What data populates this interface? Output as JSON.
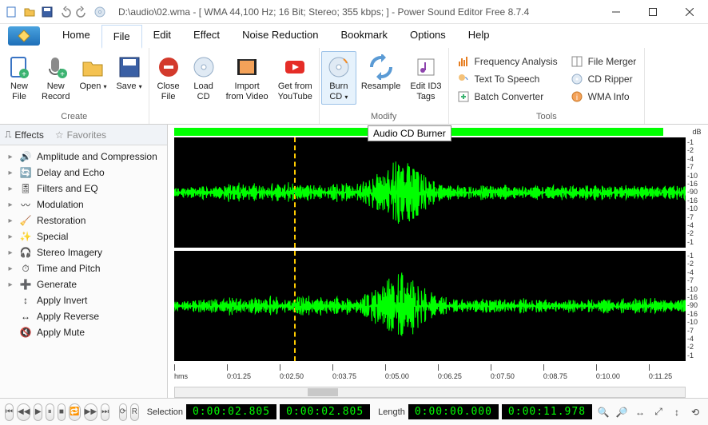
{
  "window": {
    "title": "D:\\audio\\02.wma - [ WMA 44,100 Hz; 16 Bit; Stereo; 355 kbps; ] - Power Sound Editor Free 8.7.4"
  },
  "menu": [
    "Home",
    "File",
    "Edit",
    "Effect",
    "Noise Reduction",
    "Bookmark",
    "Options",
    "Help"
  ],
  "active_menu": "File",
  "ribbon": {
    "groups": [
      {
        "label": "Create",
        "items": [
          {
            "id": "new-file",
            "label": "New\nFile"
          },
          {
            "id": "new-record",
            "label": "New\nRecord"
          },
          {
            "id": "open",
            "label": "Open",
            "drop": true
          },
          {
            "id": "save",
            "label": "Save",
            "drop": true
          }
        ]
      },
      {
        "label": "",
        "items": [
          {
            "id": "close-file",
            "label": "Close\nFile"
          },
          {
            "id": "load-cd",
            "label": "Load\nCD"
          },
          {
            "id": "import-video",
            "label": "Import\nfrom Video"
          },
          {
            "id": "get-youtube",
            "label": "Get from\nYouTube"
          }
        ]
      },
      {
        "label": "Modify",
        "items": [
          {
            "id": "burn-cd",
            "label": "Burn\nCD",
            "drop": true,
            "active": true
          },
          {
            "id": "resample",
            "label": "Resample"
          },
          {
            "id": "edit-id3",
            "label": "Edit ID3\nTags"
          }
        ]
      },
      {
        "label": "Tools",
        "right": true,
        "small": [
          {
            "id": "frequency-analysis",
            "label": "Frequency Analysis"
          },
          {
            "id": "text-to-speech",
            "label": "Text To Speech"
          },
          {
            "id": "batch-converter",
            "label": "Batch Converter"
          }
        ],
        "small2": [
          {
            "id": "file-merger",
            "label": "File Merger"
          },
          {
            "id": "cd-ripper",
            "label": "CD Ripper"
          },
          {
            "id": "wma-info",
            "label": "WMA Info"
          }
        ]
      }
    ]
  },
  "tooltip": "Audio CD Burner",
  "sidebar": {
    "tabs": [
      {
        "id": "effects",
        "label": "Effects",
        "active": true
      },
      {
        "id": "favorites",
        "label": "Favorites"
      }
    ],
    "items": [
      {
        "label": "Amplitude and Compression",
        "exp": true
      },
      {
        "label": "Delay and Echo",
        "exp": true
      },
      {
        "label": "Filters and EQ",
        "exp": true
      },
      {
        "label": "Modulation",
        "exp": true
      },
      {
        "label": "Restoration",
        "exp": true
      },
      {
        "label": "Special",
        "exp": true
      },
      {
        "label": "Stereo Imagery",
        "exp": true
      },
      {
        "label": "Time and Pitch",
        "exp": true
      },
      {
        "label": "Generate",
        "exp": true
      },
      {
        "label": "Apply Invert",
        "exp": false
      },
      {
        "label": "Apply Reverse",
        "exp": false
      },
      {
        "label": "Apply Mute",
        "exp": false
      }
    ]
  },
  "db_labels": [
    "-1",
    "-2",
    "-4",
    "-7",
    "-10",
    "-16",
    "-90",
    "-16",
    "-10",
    "-7",
    "-4",
    "-2",
    "-1"
  ],
  "db_header": "dB",
  "time_labels": [
    "hms",
    "0:01.25",
    "0:02.50",
    "0:03.75",
    "0:05.00",
    "0:06.25",
    "0:07.50",
    "0:08.75",
    "0:10.00",
    "0:11.25"
  ],
  "status": {
    "selection_label": "Selection",
    "selection_start": "0:00:02.805",
    "selection_end": "0:00:02.805",
    "length_label": "Length",
    "length_start": "0:00:00.000",
    "length_end": "0:00:11.978"
  }
}
